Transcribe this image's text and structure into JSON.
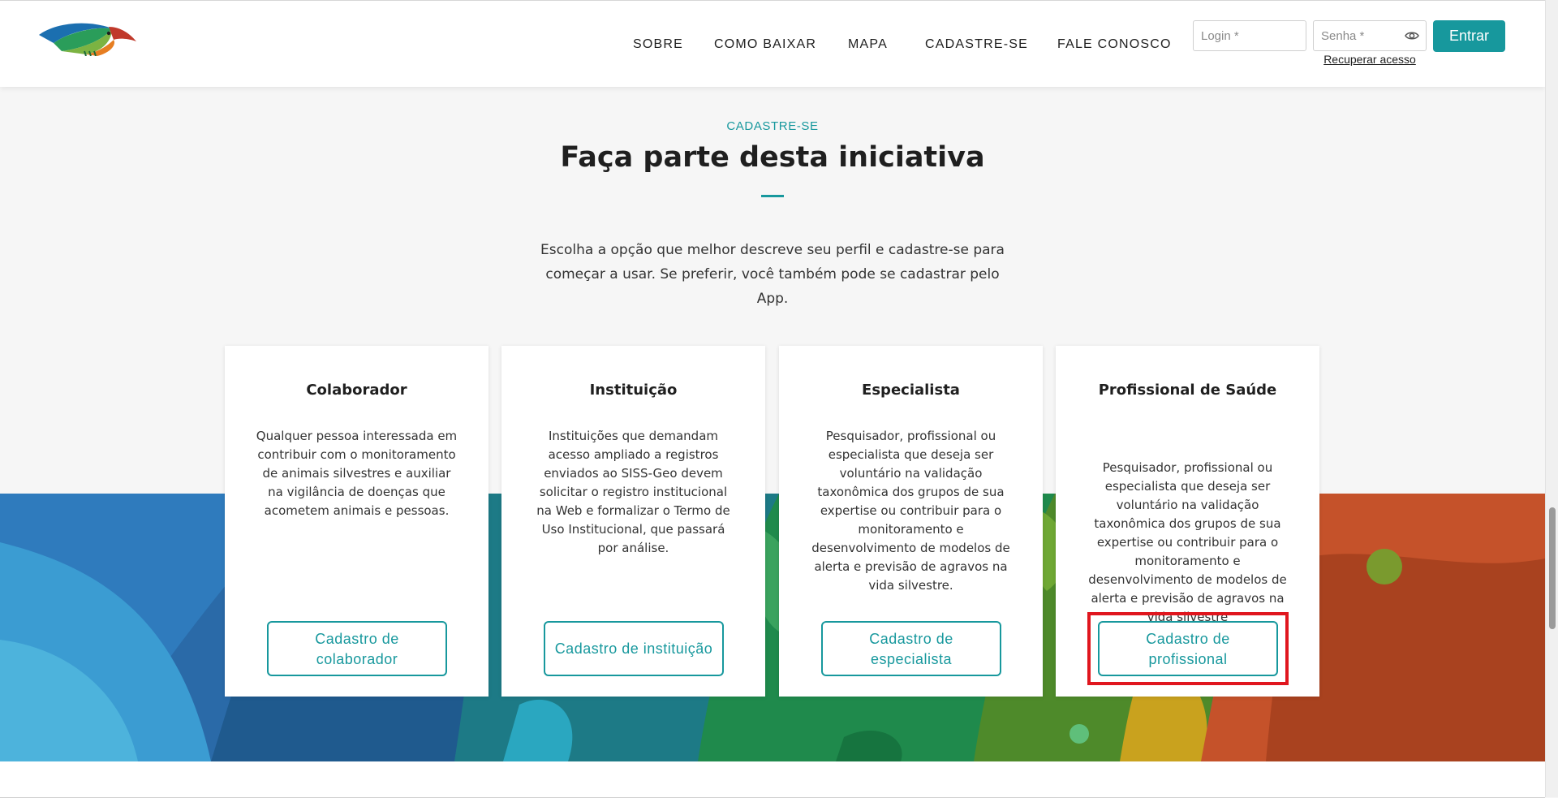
{
  "header": {
    "nav": [
      {
        "label": "SOBRE"
      },
      {
        "label": "COMO BAIXAR"
      },
      {
        "label": "MAPA"
      },
      {
        "label": "CADASTRE-SE"
      },
      {
        "label": "FALE CONOSCO"
      }
    ],
    "login_placeholder": "Login *",
    "password_placeholder": "Senha *",
    "enter_label": "Entrar",
    "recover_label": "Recuperar acesso"
  },
  "section": {
    "eyebrow": "CADASTRE-SE",
    "title": "Faça parte desta iniciativa",
    "intro": "Escolha a opção que melhor descreve seu perfil e cadastre-se para começar a usar. Se preferir, você também pode se cadastrar pelo App."
  },
  "cards": [
    {
      "title": "Colaborador",
      "description": "Qualquer pessoa interessada em contribuir com o monitoramento de animais silvestres e auxiliar na vigilância de doenças que acometem animais e pessoas.",
      "button": "Cadastro de colaborador"
    },
    {
      "title": "Instituição",
      "description": "Instituições que demandam acesso ampliado a registros enviados ao SISS-Geo devem solicitar o registro institucional na Web e formalizar o Termo de Uso Institucional, que passará por análise.",
      "button": "Cadastro de instituição"
    },
    {
      "title": "Especialista",
      "description": "Pesquisador, profissional ou especialista que deseja ser voluntário na validação taxonômica dos grupos de sua expertise ou contribuir para o monitoramento e desenvolvimento de modelos de alerta e previsão de agravos na vida silvestre.",
      "button": "Cadastro de especialista"
    },
    {
      "title": "Profissional de Saúde",
      "description": "Pesquisador, profissional ou especialista que deseja ser voluntário na validação taxonômica dos grupos de sua expertise ou contribuir para o monitoramento e desenvolvimento de modelos de alerta e previsão de agravos na vida silvestre",
      "button": "Cadastro de profissional"
    }
  ],
  "colors": {
    "accent": "#17989d",
    "highlight": "#e0161e"
  },
  "icons": {
    "logo": "siss-geo-bird-logo",
    "password_toggle": "eye-icon"
  }
}
